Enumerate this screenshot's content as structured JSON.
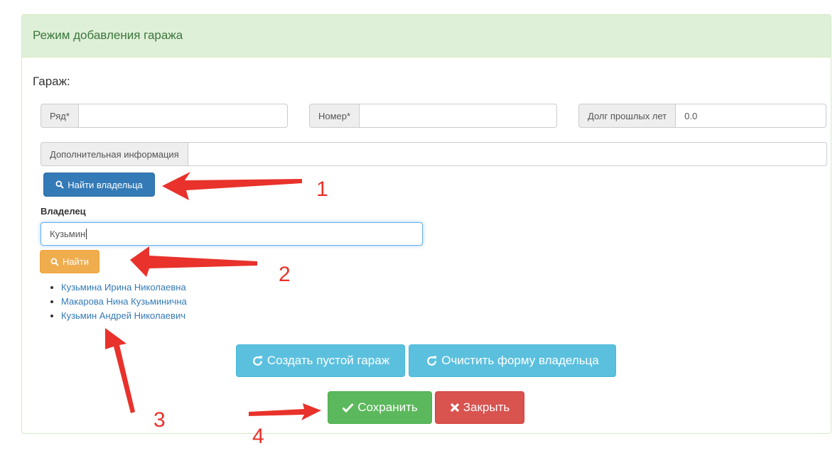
{
  "panel": {
    "title": "Режим добавления гаража"
  },
  "garage": {
    "section_label": "Гараж:",
    "row_label": "Ряд*",
    "row_value": "",
    "number_label": "Номер*",
    "number_value": "",
    "debt_label": "Долг прошлых лет",
    "debt_value": "0.0",
    "extra_label": "Дополнительная информация",
    "extra_value": ""
  },
  "find_owner_button": {
    "label": "Найти владельца",
    "icon": "search-icon"
  },
  "owner": {
    "label": "Владелец",
    "search_value": "Кузьмин",
    "find_button": {
      "label": "Найти",
      "icon": "search-icon"
    },
    "results": [
      "Кузьмина Ирина Николаевна",
      "Макарова Нина Кузьминична",
      "Кузьмин Андрей Николаевич"
    ]
  },
  "actions": {
    "create_empty": {
      "label": "Создать пустой гараж",
      "icon": "refresh-icon"
    },
    "clear_owner": {
      "label": "Очистить форму владельца",
      "icon": "refresh-icon"
    },
    "save": {
      "label": "Сохранить",
      "icon": "check-icon"
    },
    "close": {
      "label": "Закрыть",
      "icon": "close-icon"
    }
  },
  "annotations": {
    "n1": "1",
    "n2": "2",
    "n3": "3",
    "n4": "4",
    "color": "#e8322b"
  },
  "colors": {
    "heading_bg": "#dff0d8",
    "heading_text": "#3c763d",
    "primary": "#337ab7",
    "warning": "#f0ad4e",
    "info": "#5bc0de",
    "success": "#5cb85c",
    "danger": "#d9534f",
    "link": "#337ab7"
  }
}
